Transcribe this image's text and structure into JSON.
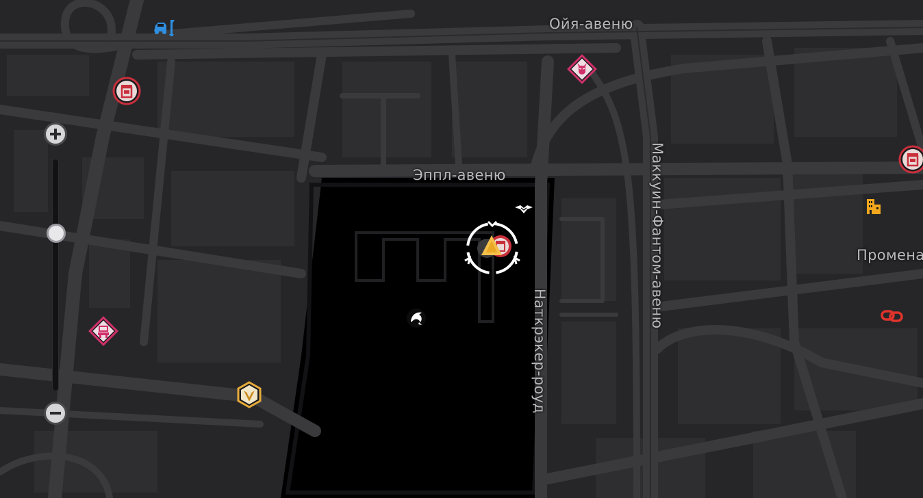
{
  "map": {
    "streets": [
      {
        "id": "oyya",
        "label": "Ойя-авеню"
      },
      {
        "id": "eppl",
        "label": "Эппл-авеню"
      },
      {
        "id": "makkuin",
        "label": "Маккуин-Фантом-авеню"
      },
      {
        "id": "natkreker",
        "label": "Наткрэкер-роуд"
      },
      {
        "id": "promena",
        "label": "Промена"
      }
    ],
    "markers": [
      {
        "id": "garage",
        "icon": "car-wrench-icon",
        "color": "#2f8fe0"
      },
      {
        "id": "trash-1",
        "icon": "trash-can-icon",
        "color": "#c9303c"
      },
      {
        "id": "trash-2",
        "icon": "trash-can-icon",
        "color": "#c9303c"
      },
      {
        "id": "mask-shop",
        "icon": "mask-icon",
        "color": "#d0306a"
      },
      {
        "id": "arcade",
        "icon": "arcade-machine-icon",
        "color": "#d0306a"
      },
      {
        "id": "hex-badge",
        "icon": "hexagon-badge-icon",
        "color": "#e7ab3a"
      },
      {
        "id": "building",
        "icon": "building-icon",
        "color": "#f2a81d"
      },
      {
        "id": "chain-link",
        "icon": "chain-link-icon",
        "color": "#e0342c"
      },
      {
        "id": "player",
        "icon": "player-location-icon",
        "color": "#ffffff"
      },
      {
        "id": "crow",
        "icon": "bird-icon",
        "color": "#ffffff"
      },
      {
        "id": "dolphin",
        "icon": "dolphin-icon",
        "color": "#ffffff"
      }
    ]
  },
  "zoom": {
    "in_icon": "plus-icon",
    "out_icon": "minus-icon",
    "level": 0.68
  },
  "colors": {
    "background": "#1b1b1d",
    "roads": "#3a3a3d",
    "water": "#000000",
    "labels": "#b9b9bd"
  }
}
